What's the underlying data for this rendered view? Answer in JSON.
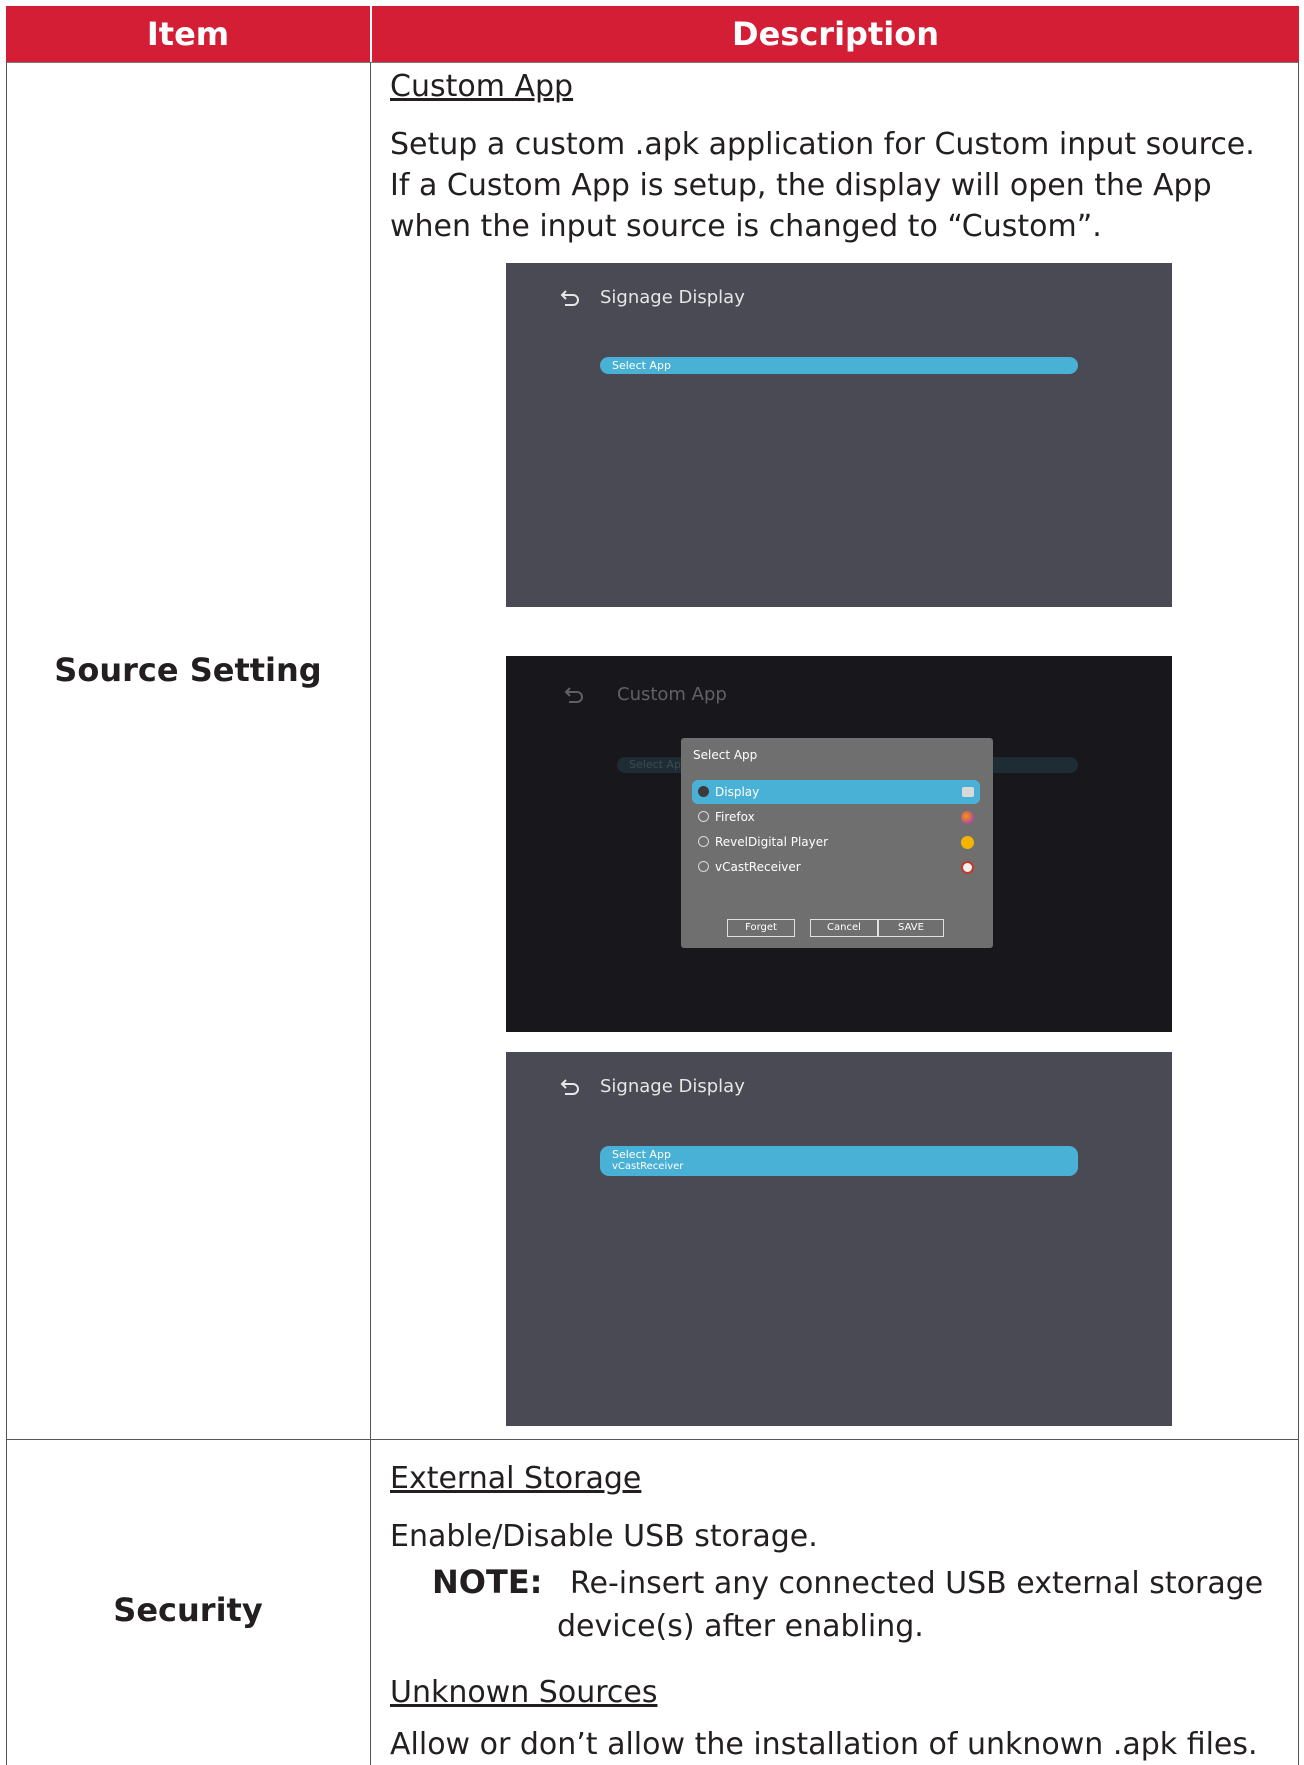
{
  "table": {
    "headers": {
      "item": "Item",
      "description": "Description"
    }
  },
  "rows": [
    {
      "item": "Source Setting",
      "subheading": "Custom App",
      "text": "Setup a custom .apk application for Custom input source. If a Custom App is setup, the display will open the App when the input source is changed to “Custom”.",
      "screens": [
        {
          "title": "Signage Display",
          "pill": "Select App"
        },
        {
          "title": "Custom App",
          "pill": "Select App",
          "dialog": {
            "title": "Select App",
            "options": [
              "Display",
              "Firefox",
              "RevelDigital Player",
              "vCastReceiver"
            ],
            "selected": "Display",
            "buttons": {
              "forget": "Forget",
              "cancel": "Cancel",
              "save": "SAVE"
            }
          }
        },
        {
          "title": "Signage Display",
          "pill": "Select App",
          "pill_value": "vCastReceiver"
        }
      ]
    },
    {
      "item": "Security",
      "subheading1": "External Storage",
      "text1": "Enable/Disable USB storage.",
      "note_label": "NOTE:",
      "note_line1": "Re-insert any connected USB external storage",
      "note_line2": "device(s) after enabling.",
      "subheading2": "Unknown Sources",
      "text2": "Allow or don’t allow the installation of unknown .apk files."
    }
  ],
  "colors": {
    "header_bg": "#d31e35",
    "pill": "#4ab1d6",
    "screen_bg": "#4a4a54"
  },
  "icons": [
    "back-arrow-icon",
    "display-app-icon",
    "firefox-icon",
    "reveldigital-icon",
    "vcast-icon"
  ]
}
